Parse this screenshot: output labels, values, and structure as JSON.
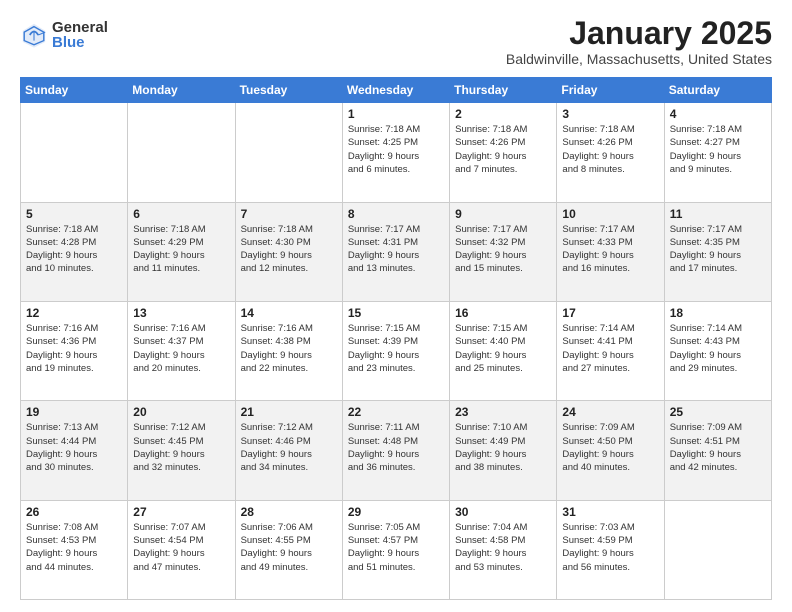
{
  "header": {
    "logo_general": "General",
    "logo_blue": "Blue",
    "month_title": "January 2025",
    "location": "Baldwinville, Massachusetts, United States"
  },
  "days_of_week": [
    "Sunday",
    "Monday",
    "Tuesday",
    "Wednesday",
    "Thursday",
    "Friday",
    "Saturday"
  ],
  "weeks": [
    [
      {
        "day": "",
        "info": ""
      },
      {
        "day": "",
        "info": ""
      },
      {
        "day": "",
        "info": ""
      },
      {
        "day": "1",
        "info": "Sunrise: 7:18 AM\nSunset: 4:25 PM\nDaylight: 9 hours\nand 6 minutes."
      },
      {
        "day": "2",
        "info": "Sunrise: 7:18 AM\nSunset: 4:26 PM\nDaylight: 9 hours\nand 7 minutes."
      },
      {
        "day": "3",
        "info": "Sunrise: 7:18 AM\nSunset: 4:26 PM\nDaylight: 9 hours\nand 8 minutes."
      },
      {
        "day": "4",
        "info": "Sunrise: 7:18 AM\nSunset: 4:27 PM\nDaylight: 9 hours\nand 9 minutes."
      }
    ],
    [
      {
        "day": "5",
        "info": "Sunrise: 7:18 AM\nSunset: 4:28 PM\nDaylight: 9 hours\nand 10 minutes."
      },
      {
        "day": "6",
        "info": "Sunrise: 7:18 AM\nSunset: 4:29 PM\nDaylight: 9 hours\nand 11 minutes."
      },
      {
        "day": "7",
        "info": "Sunrise: 7:18 AM\nSunset: 4:30 PM\nDaylight: 9 hours\nand 12 minutes."
      },
      {
        "day": "8",
        "info": "Sunrise: 7:17 AM\nSunset: 4:31 PM\nDaylight: 9 hours\nand 13 minutes."
      },
      {
        "day": "9",
        "info": "Sunrise: 7:17 AM\nSunset: 4:32 PM\nDaylight: 9 hours\nand 15 minutes."
      },
      {
        "day": "10",
        "info": "Sunrise: 7:17 AM\nSunset: 4:33 PM\nDaylight: 9 hours\nand 16 minutes."
      },
      {
        "day": "11",
        "info": "Sunrise: 7:17 AM\nSunset: 4:35 PM\nDaylight: 9 hours\nand 17 minutes."
      }
    ],
    [
      {
        "day": "12",
        "info": "Sunrise: 7:16 AM\nSunset: 4:36 PM\nDaylight: 9 hours\nand 19 minutes."
      },
      {
        "day": "13",
        "info": "Sunrise: 7:16 AM\nSunset: 4:37 PM\nDaylight: 9 hours\nand 20 minutes."
      },
      {
        "day": "14",
        "info": "Sunrise: 7:16 AM\nSunset: 4:38 PM\nDaylight: 9 hours\nand 22 minutes."
      },
      {
        "day": "15",
        "info": "Sunrise: 7:15 AM\nSunset: 4:39 PM\nDaylight: 9 hours\nand 23 minutes."
      },
      {
        "day": "16",
        "info": "Sunrise: 7:15 AM\nSunset: 4:40 PM\nDaylight: 9 hours\nand 25 minutes."
      },
      {
        "day": "17",
        "info": "Sunrise: 7:14 AM\nSunset: 4:41 PM\nDaylight: 9 hours\nand 27 minutes."
      },
      {
        "day": "18",
        "info": "Sunrise: 7:14 AM\nSunset: 4:43 PM\nDaylight: 9 hours\nand 29 minutes."
      }
    ],
    [
      {
        "day": "19",
        "info": "Sunrise: 7:13 AM\nSunset: 4:44 PM\nDaylight: 9 hours\nand 30 minutes."
      },
      {
        "day": "20",
        "info": "Sunrise: 7:12 AM\nSunset: 4:45 PM\nDaylight: 9 hours\nand 32 minutes."
      },
      {
        "day": "21",
        "info": "Sunrise: 7:12 AM\nSunset: 4:46 PM\nDaylight: 9 hours\nand 34 minutes."
      },
      {
        "day": "22",
        "info": "Sunrise: 7:11 AM\nSunset: 4:48 PM\nDaylight: 9 hours\nand 36 minutes."
      },
      {
        "day": "23",
        "info": "Sunrise: 7:10 AM\nSunset: 4:49 PM\nDaylight: 9 hours\nand 38 minutes."
      },
      {
        "day": "24",
        "info": "Sunrise: 7:09 AM\nSunset: 4:50 PM\nDaylight: 9 hours\nand 40 minutes."
      },
      {
        "day": "25",
        "info": "Sunrise: 7:09 AM\nSunset: 4:51 PM\nDaylight: 9 hours\nand 42 minutes."
      }
    ],
    [
      {
        "day": "26",
        "info": "Sunrise: 7:08 AM\nSunset: 4:53 PM\nDaylight: 9 hours\nand 44 minutes."
      },
      {
        "day": "27",
        "info": "Sunrise: 7:07 AM\nSunset: 4:54 PM\nDaylight: 9 hours\nand 47 minutes."
      },
      {
        "day": "28",
        "info": "Sunrise: 7:06 AM\nSunset: 4:55 PM\nDaylight: 9 hours\nand 49 minutes."
      },
      {
        "day": "29",
        "info": "Sunrise: 7:05 AM\nSunset: 4:57 PM\nDaylight: 9 hours\nand 51 minutes."
      },
      {
        "day": "30",
        "info": "Sunrise: 7:04 AM\nSunset: 4:58 PM\nDaylight: 9 hours\nand 53 minutes."
      },
      {
        "day": "31",
        "info": "Sunrise: 7:03 AM\nSunset: 4:59 PM\nDaylight: 9 hours\nand 56 minutes."
      },
      {
        "day": "",
        "info": ""
      }
    ]
  ]
}
